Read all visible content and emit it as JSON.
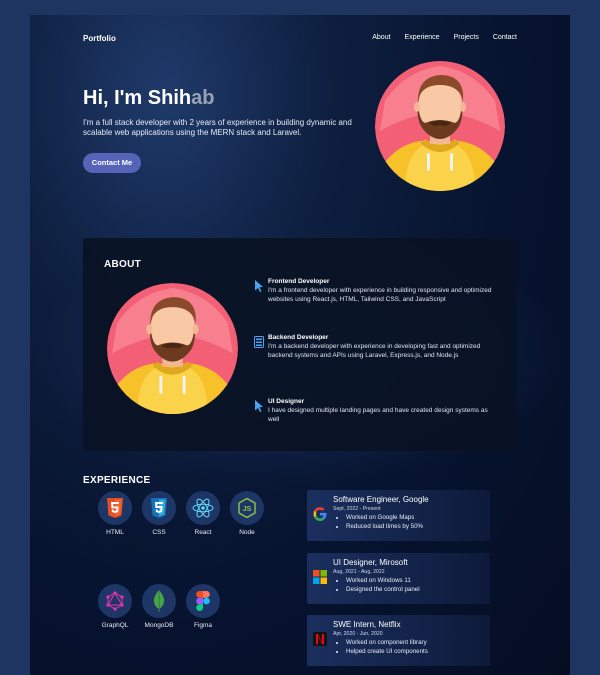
{
  "nav": {
    "logo": "Portfolio",
    "links": [
      "About",
      "Experience",
      "Projects",
      "Contact"
    ]
  },
  "hero": {
    "title_main": "Hi, I'm Shih",
    "title_faded": "ab",
    "description": "I'm a full stack developer with 2 years of experience in building dynamic and scalable web applications using the MERN stack and Laravel.",
    "cta_label": "Contact Me"
  },
  "about": {
    "title": "ABOUT",
    "items": [
      {
        "icon": "cursor-icon",
        "title": "Frontend Developer",
        "text": "I'm a frontend developer with experience in building responsive and optimized websites using React.js, HTML, Tailwind CSS, and JavaScript"
      },
      {
        "icon": "server-icon",
        "title": "Backend Developer",
        "text": "I'm a backend developer with experience in developing fast and optimized backend systems and APIs using Laravel, Express.js, and Node.js"
      },
      {
        "icon": "cursor-icon",
        "title": "UI Designer",
        "text": "I have designed multiple landing pages and have created design systems as well"
      }
    ]
  },
  "experience": {
    "title": "EXPERIENCE",
    "skills": [
      "HTML",
      "CSS",
      "React",
      "Node",
      "GraphQL",
      "MongoDB",
      "Figma"
    ],
    "jobs": [
      {
        "logo": "google-logo",
        "title": "Software Engineer, Google",
        "dates": "Sept, 2022 - Present",
        "points": [
          "Worked on Google Maps",
          "Reduced load times by 50%"
        ]
      },
      {
        "logo": "microsoft-logo",
        "title": "UI Designer, Mirosoft",
        "dates": "Aug, 2021 - Aug, 2022",
        "points": [
          "Worked on Windows 11",
          "Designed the control panel"
        ]
      },
      {
        "logo": "netflix-logo",
        "title": "SWE Intern, Netflix",
        "dates": "Apr, 2020 - Jun, 2020",
        "points": [
          "Worked on component library",
          "Helped create UI components"
        ]
      }
    ]
  },
  "colors": {
    "page_bg": "#1e3461",
    "button": "#5563b8",
    "skill_circle": "#1e3666",
    "avatar_bg": "#f35f75"
  }
}
